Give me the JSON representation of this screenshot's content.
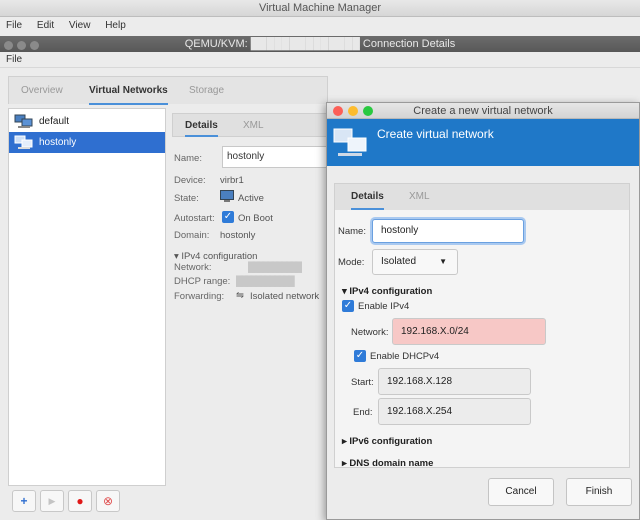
{
  "app": {
    "title": "Virtual Machine Manager",
    "menu": [
      "File",
      "Edit",
      "View",
      "Help"
    ]
  },
  "connection_window": {
    "title": "QEMU/KVM: ██████████████ Connection Details",
    "menu": [
      "File"
    ],
    "tabs": [
      "Overview",
      "Virtual Networks",
      "Storage"
    ],
    "active_tab": "Virtual Networks",
    "networks": [
      {
        "name": "default",
        "selected": false
      },
      {
        "name": "hostonly",
        "selected": true
      }
    ],
    "detail": {
      "tabs": [
        "Details",
        "XML"
      ],
      "name_label": "Name:",
      "name_value": "hostonly",
      "device_label": "Device:",
      "device_value": "virbr1",
      "state_label": "State:",
      "state_value": "Active",
      "autostart_label": "Autostart:",
      "autostart_value": "On Boot",
      "domain_label": "Domain:",
      "domain_value": "hostonly",
      "ipv4_section": "IPv4 configuration",
      "network_label": "Network:",
      "network_value": "███████████",
      "dhcp_label": "DHCP range:",
      "dhcp_value": "████████████",
      "forwarding_label": "Forwarding:",
      "forwarding_value": "Isolated network"
    },
    "bottom_buttons": [
      {
        "name": "add-network-button",
        "glyph": "+"
      },
      {
        "name": "start-network-button",
        "glyph": "▶"
      },
      {
        "name": "stop-network-button",
        "glyph": "●"
      },
      {
        "name": "delete-network-button",
        "glyph": "⊗"
      }
    ]
  },
  "dialog": {
    "title": "Create a new virtual network",
    "banner_title": "Create virtual network",
    "tabs": [
      "Details",
      "XML"
    ],
    "active_tab": "Details",
    "name_label": "Name:",
    "name_value": "hostonly",
    "mode_label": "Mode:",
    "mode_value": "Isolated",
    "ipv4_section": "IPv4 configuration",
    "enable_ipv4_label": "Enable IPv4",
    "network_label": "Network:",
    "network_value": "192.168.X.0/24",
    "enable_dhcp_label": "Enable DHCPv4",
    "start_label": "Start:",
    "start_value": "192.168.X.128",
    "end_label": "End:",
    "end_value": "192.168.X.254",
    "ipv6_section": "IPv6 configuration",
    "dns_section": "DNS domain name",
    "cancel_label": "Cancel",
    "finish_label": "Finish"
  },
  "colors": {
    "accent": "#2f7bd8",
    "banner": "#1f78c8",
    "selection": "#2f6fd0",
    "error_field": "#f7c8c6",
    "close": "#fc5f57",
    "minimize": "#fdbc2e",
    "zoom": "#29c940"
  }
}
